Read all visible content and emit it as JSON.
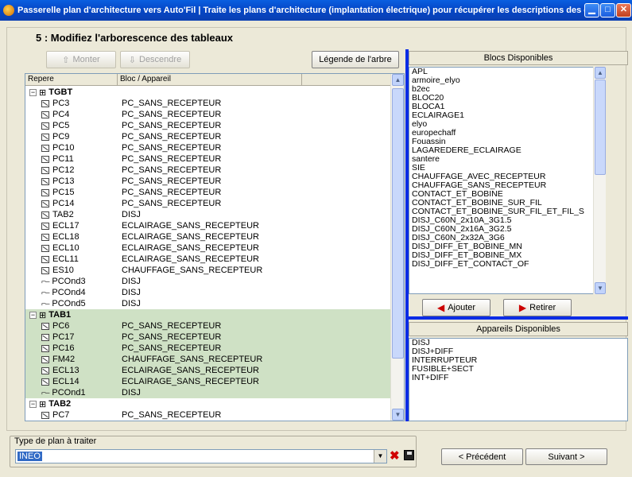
{
  "window": {
    "title": "Passerelle plan d'architecture vers Auto'Fil | Traite les plans d'architecture (implantation électrique) pour récupérer les descriptions des départs ..."
  },
  "step_title": "5 : Modifiez l'arborescence des tableaux",
  "toolbar": {
    "up_label": "Monter",
    "down_label": "Descendre",
    "legend_label": "Légende de l'arbre"
  },
  "tree": {
    "col_repere": "Repere",
    "col_bloc": "Bloc / Appareil",
    "rows": [
      {
        "level": 0,
        "type": "tab",
        "repere": "TGBT",
        "bloc": "",
        "hl": false
      },
      {
        "level": 1,
        "type": "box",
        "repere": "PC3",
        "bloc": "PC_SANS_RECEPTEUR",
        "hl": false
      },
      {
        "level": 1,
        "type": "box",
        "repere": "PC4",
        "bloc": "PC_SANS_RECEPTEUR",
        "hl": false
      },
      {
        "level": 1,
        "type": "box",
        "repere": "PC5",
        "bloc": "PC_SANS_RECEPTEUR",
        "hl": false
      },
      {
        "level": 1,
        "type": "box",
        "repere": "PC9",
        "bloc": "PC_SANS_RECEPTEUR",
        "hl": false
      },
      {
        "level": 1,
        "type": "box",
        "repere": "PC10",
        "bloc": "PC_SANS_RECEPTEUR",
        "hl": false
      },
      {
        "level": 1,
        "type": "box",
        "repere": "PC11",
        "bloc": "PC_SANS_RECEPTEUR",
        "hl": false
      },
      {
        "level": 1,
        "type": "box",
        "repere": "PC12",
        "bloc": "PC_SANS_RECEPTEUR",
        "hl": false
      },
      {
        "level": 1,
        "type": "box",
        "repere": "PC13",
        "bloc": "PC_SANS_RECEPTEUR",
        "hl": false
      },
      {
        "level": 1,
        "type": "box",
        "repere": "PC15",
        "bloc": "PC_SANS_RECEPTEUR",
        "hl": false
      },
      {
        "level": 1,
        "type": "box",
        "repere": "PC14",
        "bloc": "PC_SANS_RECEPTEUR",
        "hl": false
      },
      {
        "level": 1,
        "type": "box",
        "repere": "TAB2",
        "bloc": "DISJ",
        "hl": false
      },
      {
        "level": 1,
        "type": "box",
        "repere": "ECL17",
        "bloc": "ECLAIRAGE_SANS_RECEPTEUR",
        "hl": false
      },
      {
        "level": 1,
        "type": "box",
        "repere": "ECL18",
        "bloc": "ECLAIRAGE_SANS_RECEPTEUR",
        "hl": false
      },
      {
        "level": 1,
        "type": "box",
        "repere": "ECL10",
        "bloc": "ECLAIRAGE_SANS_RECEPTEUR",
        "hl": false
      },
      {
        "level": 1,
        "type": "box",
        "repere": "ECL11",
        "bloc": "ECLAIRAGE_SANS_RECEPTEUR",
        "hl": false
      },
      {
        "level": 1,
        "type": "box",
        "repere": "ES10",
        "bloc": "CHAUFFAGE_SANS_RECEPTEUR",
        "hl": false
      },
      {
        "level": 1,
        "type": "switch",
        "repere": "PCOnd3",
        "bloc": "DISJ",
        "hl": false
      },
      {
        "level": 1,
        "type": "switch",
        "repere": "PCOnd4",
        "bloc": "DISJ",
        "hl": false
      },
      {
        "level": 1,
        "type": "switch",
        "repere": "PCOnd5",
        "bloc": "DISJ",
        "hl": false
      },
      {
        "level": 0,
        "type": "tab",
        "repere": "TAB1",
        "bloc": "",
        "hl": true
      },
      {
        "level": 1,
        "type": "box",
        "repere": "PC6",
        "bloc": "PC_SANS_RECEPTEUR",
        "hl": true
      },
      {
        "level": 1,
        "type": "box",
        "repere": "PC17",
        "bloc": "PC_SANS_RECEPTEUR",
        "hl": true
      },
      {
        "level": 1,
        "type": "box",
        "repere": "PC16",
        "bloc": "PC_SANS_RECEPTEUR",
        "hl": true
      },
      {
        "level": 1,
        "type": "box",
        "repere": "FM42",
        "bloc": "CHAUFFAGE_SANS_RECEPTEUR",
        "hl": true
      },
      {
        "level": 1,
        "type": "box",
        "repere": "ECL13",
        "bloc": "ECLAIRAGE_SANS_RECEPTEUR",
        "hl": true
      },
      {
        "level": 1,
        "type": "box",
        "repere": "ECL14",
        "bloc": "ECLAIRAGE_SANS_RECEPTEUR",
        "hl": true
      },
      {
        "level": 1,
        "type": "switch",
        "repere": "PCOnd1",
        "bloc": "DISJ",
        "hl": true
      },
      {
        "level": 0,
        "type": "tab",
        "repere": "TAB2",
        "bloc": "",
        "hl": false
      },
      {
        "level": 1,
        "type": "box",
        "repere": "PC7",
        "bloc": "PC_SANS_RECEPTEUR",
        "hl": false
      }
    ]
  },
  "blocs": {
    "title": "Blocs Disponibles",
    "items": [
      "APL",
      "armoire_elyo",
      "b2ec",
      "BLOC20",
      "BLOCA1",
      "ECLAIRAGE1",
      "elyo",
      "europechaff",
      "Fouassin",
      "LAGAREDERE_ECLAIRAGE",
      "santere",
      "SIE",
      "CHAUFFAGE_AVEC_RECEPTEUR",
      "CHAUFFAGE_SANS_RECEPTEUR",
      "CONTACT_ET_BOBINE",
      "CONTACT_ET_BOBINE_SUR_FIL",
      "CONTACT_ET_BOBINE_SUR_FIL_ET_FIL_S",
      "DISJ_C60N_2x10A_3G1.5",
      "DISJ_C60N_2x16A_3G2.5",
      "DISJ_C60N_2x32A_3G6",
      "DISJ_DIFF_ET_BOBINE_MN",
      "DISJ_DIFF_ET_BOBINE_MX",
      "DISJ_DIFF_ET_CONTACT_OF"
    ],
    "add_label": "Ajouter",
    "remove_label": "Retirer"
  },
  "appareils": {
    "title": "Appareils Disponibles",
    "items": [
      "DISJ",
      "DISJ+DIFF",
      "INTERRUPTEUR",
      "FUSIBLE+SECT",
      "INT+DIFF"
    ]
  },
  "plan": {
    "label": "Type de plan à traiter",
    "value": "INEO"
  },
  "nav": {
    "prev_label": "< Précédent",
    "next_label": "Suivant >"
  },
  "colors": {
    "highlight": "#cfe1c5",
    "separator": "#0b2ce5",
    "titlebar": "#0548c8"
  }
}
